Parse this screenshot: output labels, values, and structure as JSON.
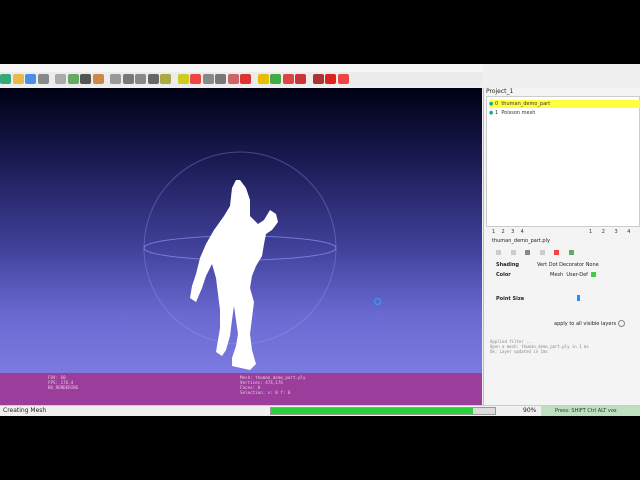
{
  "toolbar": {
    "icons": [
      "new-icon",
      "open-icon",
      "save-icon",
      "save-all-icon",
      "grid-icon",
      "eye-icon",
      "camera-icon",
      "cube-icon",
      "select-icon",
      "move-icon",
      "rotate-icon",
      "scale-icon",
      "measure-icon",
      "annotate-icon",
      "texture-icon",
      "light-icon",
      "brush-icon",
      "wand-icon",
      "paint-icon",
      "info-icon",
      "pick-icon",
      "flag-icon",
      "fill-icon",
      "tools-icon",
      "close-icon",
      "settings-icon"
    ]
  },
  "viewport": {
    "info_left": [
      "FOV: 60",
      "FPS:  176.4",
      "BO_RENDERING"
    ],
    "info_right": [
      "Mesh: thuman_demo_part.ply",
      "Vertices: 474,176",
      "Faces: 0",
      "Selection: v: 0 f: 0"
    ]
  },
  "panel": {
    "project_title": "Project_1",
    "layers": [
      {
        "index": "0",
        "name": "thuman_demo_part",
        "selected": true
      },
      {
        "index": "1",
        "name": "Poisson mesh",
        "selected": false
      }
    ],
    "tabs_left": [
      "1",
      "2",
      "3",
      "4"
    ],
    "tabs_right": [
      "1",
      "2",
      "3",
      "4"
    ],
    "layer_file": "thuman_demo_part.ply",
    "shading_label": "Shading",
    "shading_options": "Vert   Dot Decorator   None",
    "color_label": "Color",
    "color_mode": "Mesh",
    "color_value": "User-Def",
    "point_size_label": "Point Size",
    "apply_label": "apply to all visible layers",
    "log_lines": [
      "Applied filter ...",
      "Open a mesh: thuman_demo_part.ply in 1 ms",
      "Ok: Layer updated in 1ms"
    ]
  },
  "status": {
    "text": "Creating Mesh",
    "progress_label": "90%",
    "progress": 0.9,
    "fps_text": "Press: SHIFT Ctrl ALT vox"
  }
}
